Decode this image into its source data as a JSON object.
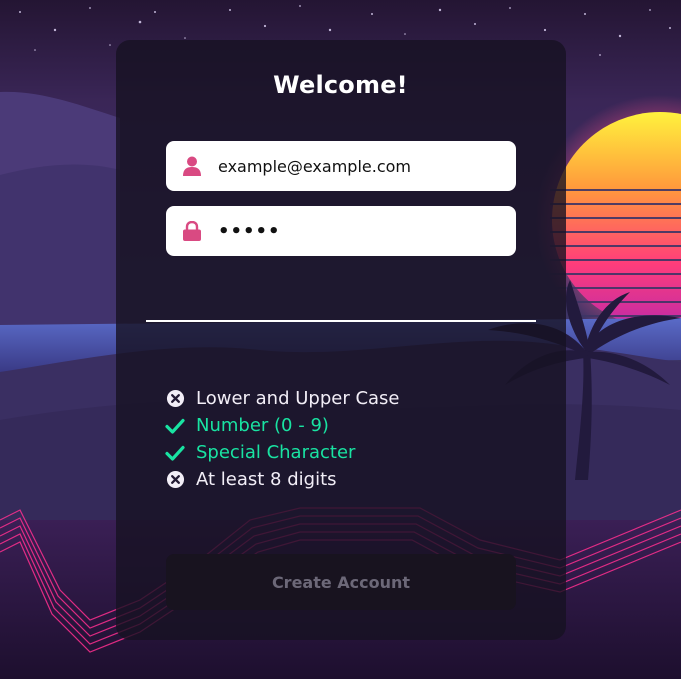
{
  "form": {
    "title": "Welcome!",
    "email": {
      "value": "example@example.com",
      "icon": "user-icon"
    },
    "password": {
      "value": "•••••",
      "icon": "lock-icon"
    },
    "rules": [
      {
        "label": "Lower and Upper Case",
        "status": "fail",
        "icon": "x-circle-icon"
      },
      {
        "label": "Number (0 - 9)",
        "status": "ok",
        "icon": "check-icon"
      },
      {
        "label": "Special Character",
        "status": "ok",
        "icon": "check-icon"
      },
      {
        "label": "At least 8 digits",
        "status": "fail",
        "icon": "x-circle-icon"
      }
    ],
    "submit_label": "Create Account"
  },
  "colors": {
    "icon_pink": "#d94a82",
    "rule_ok": "#19e3a2",
    "rule_fail": "#f2eef7"
  }
}
